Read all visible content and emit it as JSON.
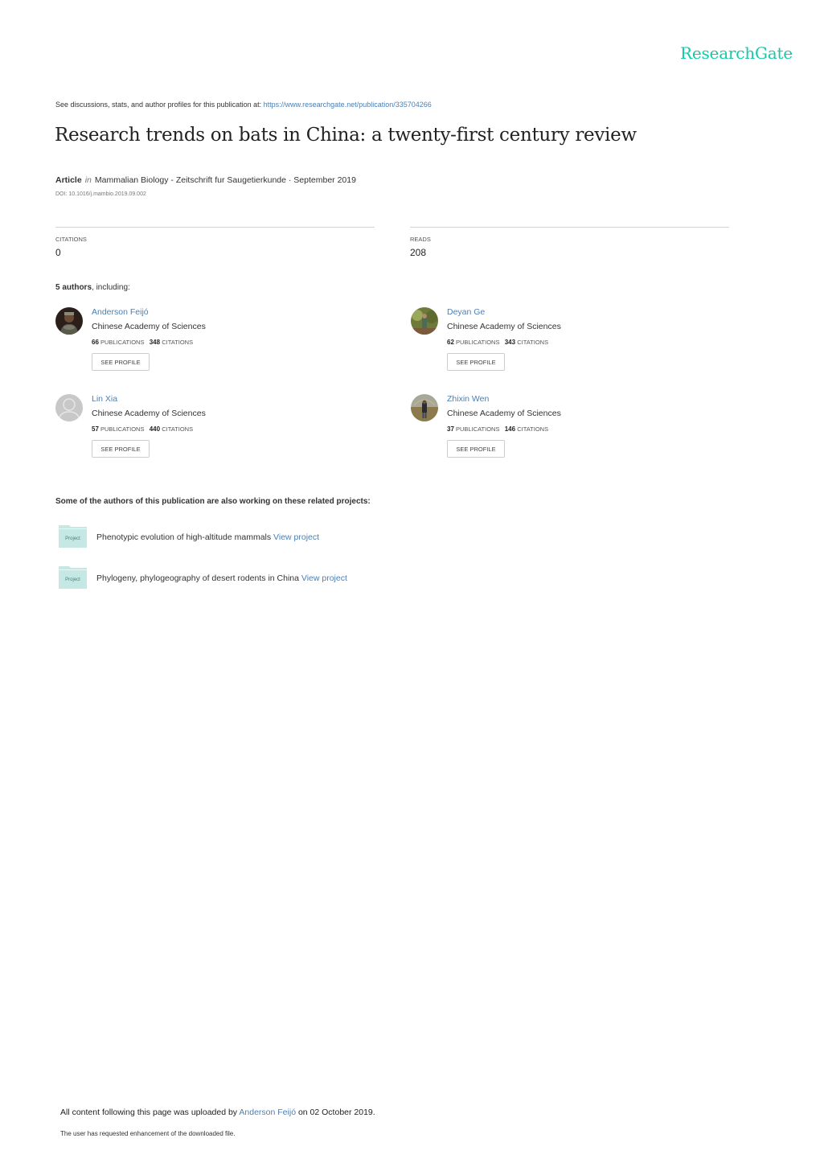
{
  "brand": {
    "logo_text": "ResearchGate",
    "accent": "#14c9a8",
    "link_color": "#4a7fb5"
  },
  "header": {
    "see_text": "See discussions, stats, and author profiles for this publication at: ",
    "url": "https://www.researchgate.net/publication/335704266"
  },
  "publication": {
    "title": "Research trends on bats in China: a twenty-first century review",
    "type": "Article",
    "in_word": "in",
    "journal_date": "Mammalian Biology - Zeitschrift fur Saugetierkunde · September 2019",
    "doi": "DOI: 10.1016/j.mambio.2019.09.002"
  },
  "stats": {
    "citations_label": "CITATIONS",
    "citations_value": "0",
    "reads_label": "READS",
    "reads_value": "208"
  },
  "authors_heading": {
    "count": "5 authors",
    "suffix": ", including:"
  },
  "authors": [
    {
      "name": "Anderson Feijó",
      "institution": "Chinese Academy of Sciences",
      "publications": "66",
      "publications_label": "PUBLICATIONS",
      "citations": "348",
      "citations_label": "CITATIONS",
      "button": "SEE PROFILE"
    },
    {
      "name": "Deyan Ge",
      "institution": "Chinese Academy of Sciences",
      "publications": "62",
      "publications_label": "PUBLICATIONS",
      "citations": "343",
      "citations_label": "CITATIONS",
      "button": "SEE PROFILE"
    },
    {
      "name": "Lin Xia",
      "institution": "Chinese Academy of Sciences",
      "publications": "57",
      "publications_label": "PUBLICATIONS",
      "citations": "440",
      "citations_label": "CITATIONS",
      "button": "SEE PROFILE"
    },
    {
      "name": "Zhixin Wen",
      "institution": "Chinese Academy of Sciences",
      "publications": "37",
      "publications_label": "PUBLICATIONS",
      "citations": "146",
      "citations_label": "CITATIONS",
      "button": "SEE PROFILE"
    }
  ],
  "projects_heading": "Some of the authors of this publication are also working on these related projects:",
  "projects": [
    {
      "icon_label": "Project",
      "title": "Phenotypic evolution of high-altitude mammals ",
      "link": "View project"
    },
    {
      "icon_label": "Project",
      "title": "Phylogeny, phylogeography of desert rodents in China ",
      "link": "View project"
    }
  ],
  "footer": {
    "prefix": "All content following this page was uploaded by ",
    "uploader": "Anderson Feijó",
    "suffix": " on 02 October 2019.",
    "note": "The user has requested enhancement of the downloaded file."
  }
}
